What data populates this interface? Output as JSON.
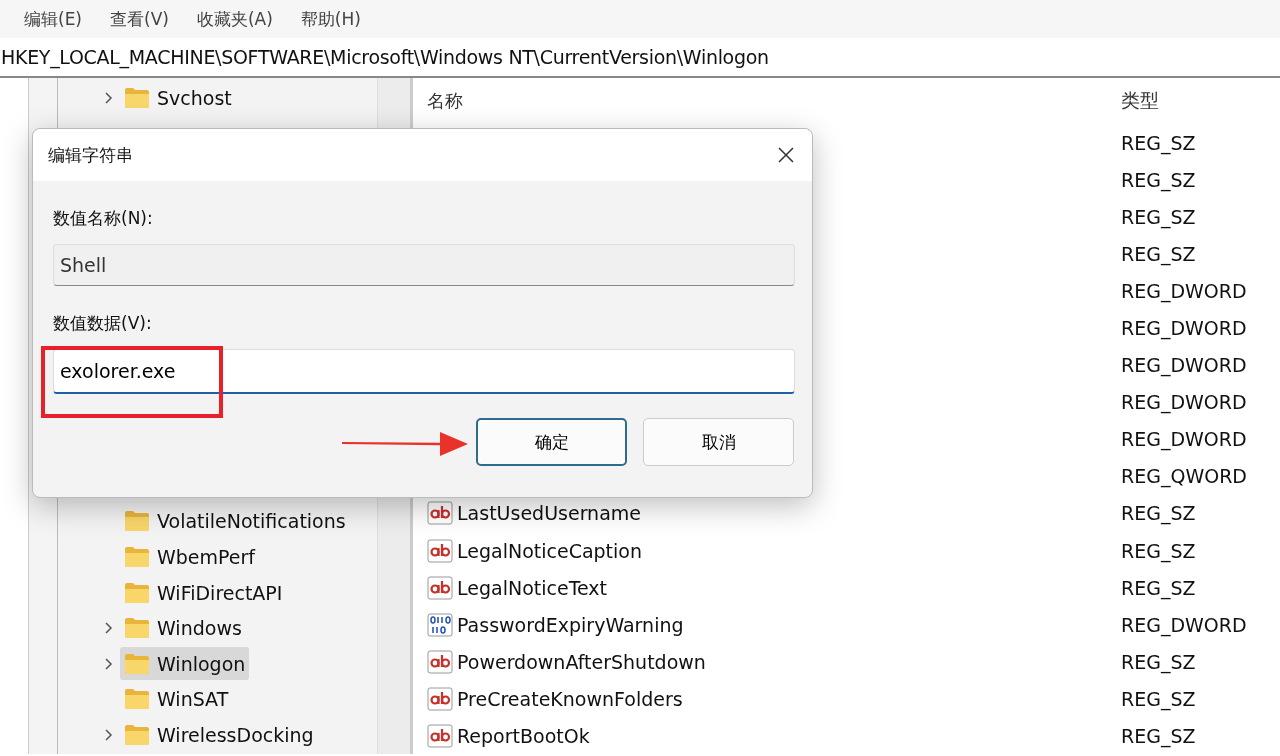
{
  "menu_bar": [
    "编辑(E)",
    "查看(V)",
    "收藏夹(A)",
    "帮助(H)"
  ],
  "address_bar": {
    "path": "HKEY_LOCAL_MACHINE\\SOFTWARE\\Microsoft\\Windows NT\\CurrentVersion\\Winlogon"
  },
  "tree": {
    "top_items": [
      {
        "label": "Svchost",
        "expandable": true,
        "selected": false
      }
    ],
    "items": [
      {
        "label": "VolatileNotifications",
        "expandable": false,
        "selected": false
      },
      {
        "label": "WbemPerf",
        "expandable": false,
        "selected": false
      },
      {
        "label": "WiFiDirectAPI",
        "expandable": false,
        "selected": false
      },
      {
        "label": "Windows",
        "expandable": true,
        "selected": false
      },
      {
        "label": "Winlogon",
        "expandable": true,
        "selected": true
      },
      {
        "label": "WinSAT",
        "expandable": false,
        "selected": false
      },
      {
        "label": "WirelessDocking",
        "expandable": true,
        "selected": false
      }
    ]
  },
  "values_table": {
    "columns": [
      "名称",
      "类型"
    ],
    "rows": [
      {
        "type": "REG_SZ"
      },
      {
        "type": "REG_SZ"
      },
      {
        "type": "REG_SZ"
      },
      {
        "type": "REG_SZ"
      },
      {
        "type": "REG_DWORD"
      },
      {
        "type": "REG_DWORD"
      },
      {
        "type": "REG_DWORD"
      },
      {
        "type": "REG_DWORD"
      },
      {
        "type": "REG_DWORD"
      },
      {
        "type": "REG_QWORD"
      },
      {
        "kind": "string",
        "name": "LastUsedUsername",
        "type": "REG_SZ"
      },
      {
        "kind": "string",
        "name": "LegalNoticeCaption",
        "type": "REG_SZ"
      },
      {
        "kind": "string",
        "name": "LegalNoticeText",
        "type": "REG_SZ"
      },
      {
        "kind": "binary",
        "name": "PasswordExpiryWarning",
        "type": "REG_DWORD"
      },
      {
        "kind": "string",
        "name": "PowerdownAfterShutdown",
        "type": "REG_SZ"
      },
      {
        "kind": "string",
        "name": "PreCreateKnownFolders",
        "type": "REG_SZ"
      },
      {
        "kind": "string",
        "name": "ReportBootOk",
        "type": "REG_SZ"
      }
    ]
  },
  "dialog": {
    "title": "编辑字符串",
    "name_label": "数值名称(N):",
    "name_value": "Shell",
    "data_label": "数值数据(V):",
    "data_value": "exolorer.exe",
    "buttons": [
      {
        "label": "确定",
        "default": true
      },
      {
        "label": "取消",
        "default": false
      }
    ]
  }
}
